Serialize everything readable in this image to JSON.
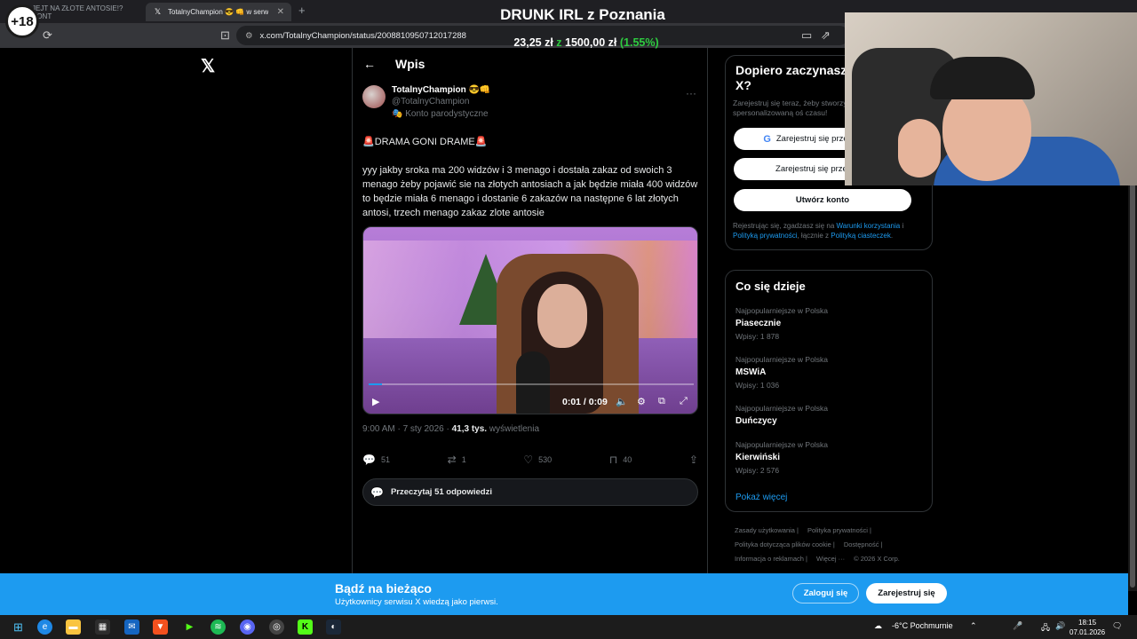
{
  "browser": {
    "tabs": [
      {
        "label": "JEJT NA ZŁOTE ANTOSIE!? KONT",
        "active": false
      },
      {
        "label": "TotalnyChampion 😎 👊 w serw",
        "active": true
      }
    ],
    "new_tab": "+",
    "url": "x.com/TotalnyChampion/status/2008810950712017288"
  },
  "overlay": {
    "age_badge": "+18",
    "stream_title": "DRUNK IRL z Poznania",
    "money_left": "23,25 zł",
    "money_z": "z",
    "money_right": "1500,00 zł",
    "money_pct": "(1.55%)"
  },
  "x_logo": "𝕏",
  "post": {
    "header_title": "Wpis",
    "author_name": "TotalnyChampion 😎👊",
    "author_handle": "@TotalnyChampion",
    "parody_label": "🎭 Konto parodystyczne",
    "text_1": "🚨DRAMA GONI DRAME🚨",
    "text_2": "yyy jakby sroka ma 200 widzów i 3 menago i dostała zakaz od swoich 3 menago żeby pojawić sie na złotych antosiach a jak będzie miała 400 widzów to będzie miała 6 menago i dostanie 6 zakazów na następne 6 lat złotych antosi, trzech menago zakaz zlote antosie",
    "video_time": "0:01 / 0:09",
    "video_progress": 0.04,
    "timestamp": "9:00 AM · 7 sty 2026 · ",
    "views_count": "41,3 tys.",
    "views_label": " wyświetlenia",
    "replies": "51",
    "reposts": "1",
    "likes": "530",
    "bookmarks": "40",
    "read_replies": "Przeczytaj 51 odpowiedzi"
  },
  "signup": {
    "heading": "Dopiero zaczynasz w serwisu X?",
    "sub": "Zarejestruj się teraz, żeby stworzyć spersonalizowaną oś czasu!",
    "google_btn": "Zarejestruj się przez Google",
    "apple_btn": "Zarejestruj się przez Apple",
    "create_btn": "Utwórz konto",
    "legal_1": "Rejestrując się, zgadzasz się na ",
    "legal_terms": "Warunki korzystania",
    "legal_2": " i ",
    "legal_privacy": "Polityką prywatności",
    "legal_3": ", łącznie z ",
    "legal_cookies": "Polityką ciasteczek",
    "legal_4": "."
  },
  "trends": {
    "heading": "Co się dzieje",
    "items": [
      {
        "category": "Najpopularniejsze w Polska",
        "name": "Piasecznie",
        "posts": "Wpisy: 1 878"
      },
      {
        "category": "Najpopularniejsze w Polska",
        "name": "MSWiA",
        "posts": "Wpisy: 1 036"
      },
      {
        "category": "Najpopularniejsze w Polska",
        "name": "Duńczycy",
        "posts": ""
      },
      {
        "category": "Najpopularniejsze w Polska",
        "name": "Kierwiński",
        "posts": "Wpisy: 2 576"
      }
    ],
    "show_more": "Pokaż więcej"
  },
  "footer": {
    "links": [
      "Zasady użytkowania |",
      "Polityka prywatności |",
      "Polityka dotycząca plików cookie |",
      "Dostępność |",
      "Informacja o reklamach |",
      "Więcej ···",
      "© 2026 X Corp."
    ]
  },
  "banner": {
    "title": "Bądź na bieżąco",
    "subtitle": "Użytkownicy serwisu X wiedzą jako pierwsi.",
    "login": "Zaloguj się",
    "register": "Zarejestruj się"
  },
  "taskbar": {
    "weather": "-6°C  Pochmurnie",
    "time": "18:15",
    "date": "07.01.2026"
  }
}
